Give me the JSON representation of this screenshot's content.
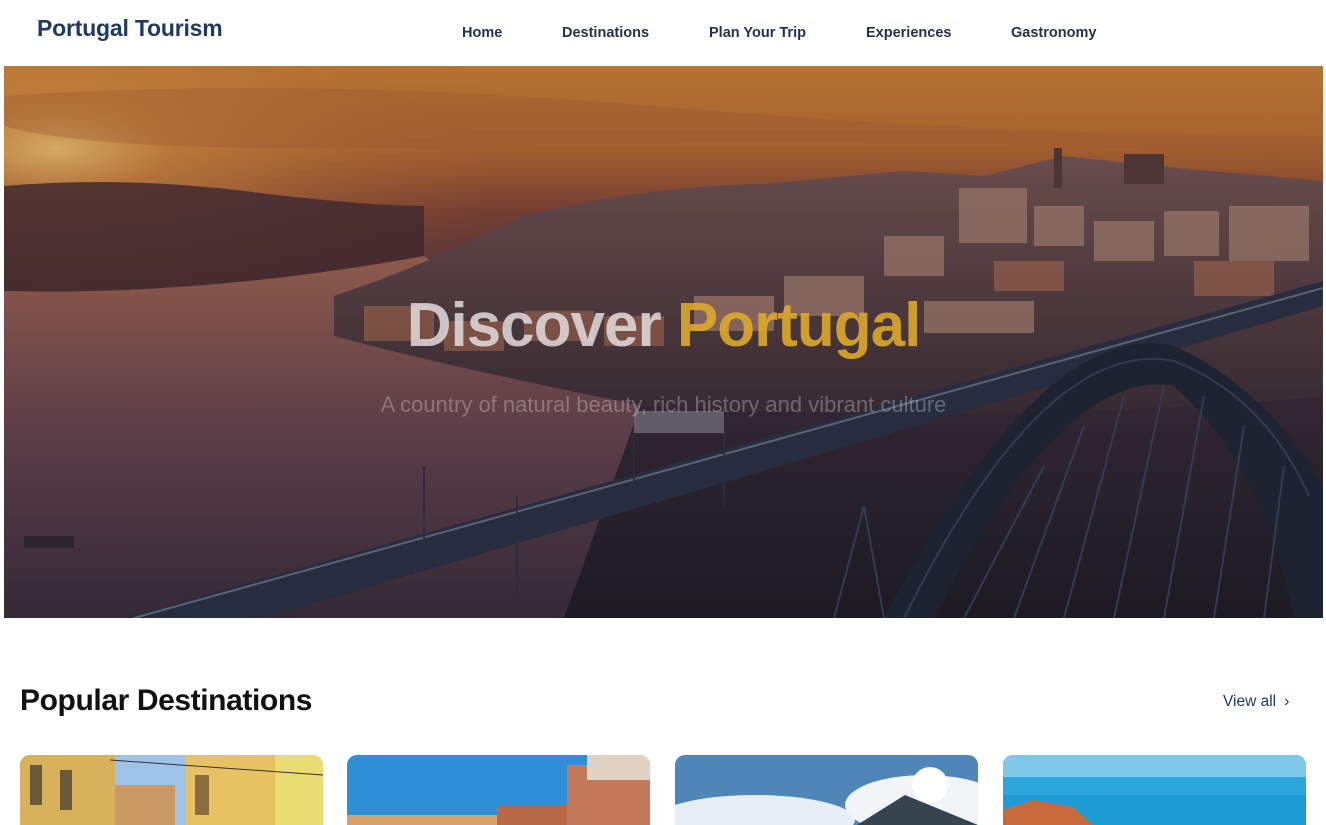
{
  "header": {
    "logo": "Portugal Tourism",
    "nav": [
      {
        "label": "Home"
      },
      {
        "label": "Destinations"
      },
      {
        "label": "Plan Your Trip"
      },
      {
        "label": "Experiences"
      },
      {
        "label": "Gastronomy"
      }
    ]
  },
  "hero": {
    "title_word1": "Discover",
    "title_word2": "Portugal",
    "subtitle": "A country of natural beauty, rich history and vibrant culture"
  },
  "destinations": {
    "title": "Popular Destinations",
    "view_all_label": "View all",
    "view_all_icon": "chevron-right-icon",
    "chevron_glyph": "›"
  },
  "colors": {
    "brand": "#1f3a60",
    "accent": "#dea82a"
  }
}
